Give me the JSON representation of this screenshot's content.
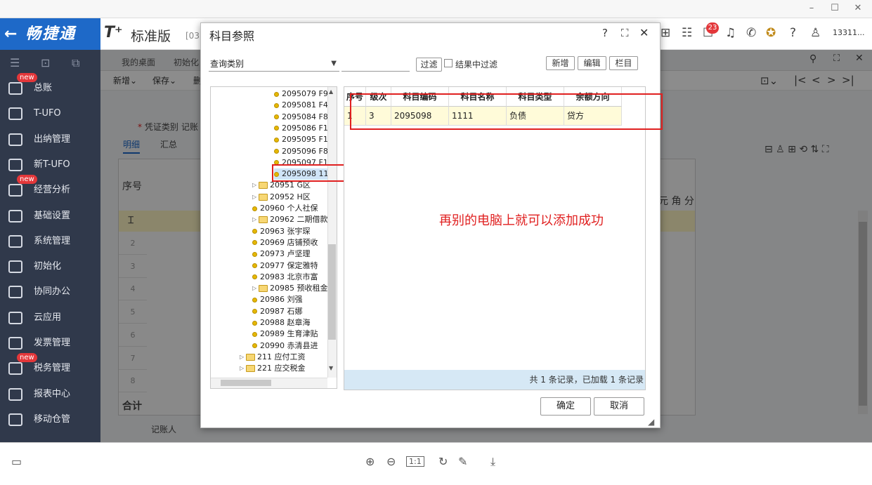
{
  "window": {
    "minimize": "–",
    "maximize": "☐",
    "close": "✕"
  },
  "brand": {
    "back_arrow": "←",
    "name": "畅捷通"
  },
  "header": {
    "logo_t": "T⁺",
    "edition": "标准版",
    "code": "[03",
    "notif_count": "23",
    "user": "13311..."
  },
  "sidebar": {
    "items": [
      {
        "label": "总账",
        "new": "new"
      },
      {
        "label": "T-UFO",
        "new": ""
      },
      {
        "label": "出纳管理",
        "new": ""
      },
      {
        "label": "新T-UFO",
        "new": ""
      },
      {
        "label": "经营分析",
        "new": "new"
      },
      {
        "label": "基础设置",
        "new": ""
      },
      {
        "label": "系统管理",
        "new": ""
      },
      {
        "label": "初始化",
        "new": ""
      },
      {
        "label": "协同办公",
        "new": ""
      },
      {
        "label": "云应用",
        "new": ""
      },
      {
        "label": "发票管理",
        "new": ""
      },
      {
        "label": "税务管理",
        "new": "new"
      },
      {
        "label": "报表中心",
        "new": ""
      },
      {
        "label": "移动仓管",
        "new": ""
      }
    ]
  },
  "tabs": {
    "desk": "我的桌面",
    "init": "初始化"
  },
  "toolbar": {
    "add": "新增",
    "save": "保存",
    "del": "删"
  },
  "form": {
    "voucher_type_label": "凭证类别",
    "voucher_type_value": "记账",
    "tab_detail": "明细",
    "tab_summary": "汇总",
    "col_seq": "序号",
    "col_units": "元 角 分",
    "total": "合计",
    "bookkeeper": "记账人",
    "rows": [
      "1",
      "2",
      "3",
      "4",
      "5",
      "6",
      "7",
      "8"
    ]
  },
  "dialog": {
    "title": "科目参照",
    "query_type": "查询类别",
    "filter_btn": "过滤",
    "filter_in_result": "结果中过滤",
    "new_btn": "新增",
    "edit_btn": "编辑",
    "column_btn": "栏目",
    "tree": [
      {
        "text": "2095079 F9",
        "kind": "leaf",
        "indent": 3
      },
      {
        "text": "2095081 F4",
        "kind": "leaf",
        "indent": 3
      },
      {
        "text": "2095084 F8",
        "kind": "leaf",
        "indent": 3
      },
      {
        "text": "2095086 F1",
        "kind": "leaf",
        "indent": 3
      },
      {
        "text": "2095095 F1",
        "kind": "leaf",
        "indent": 3
      },
      {
        "text": "2095096 F8",
        "kind": "leaf",
        "indent": 3
      },
      {
        "text": "2095097 F1",
        "kind": "leaf",
        "indent": 3
      },
      {
        "text": "2095098 11",
        "kind": "leaf",
        "indent": 3
      },
      {
        "text": "20951 G区",
        "kind": "folder",
        "indent": 2
      },
      {
        "text": "20952 H区",
        "kind": "folder",
        "indent": 2
      },
      {
        "text": "20960 个人社保",
        "kind": "leaf",
        "indent": 2
      },
      {
        "text": "20962 二期借款",
        "kind": "folder",
        "indent": 2
      },
      {
        "text": "20963 张宇琛",
        "kind": "leaf",
        "indent": 2
      },
      {
        "text": "20969 店铺预收",
        "kind": "leaf",
        "indent": 2
      },
      {
        "text": "20973 卢坚理",
        "kind": "leaf",
        "indent": 2
      },
      {
        "text": "20977 保定雅特",
        "kind": "leaf",
        "indent": 2
      },
      {
        "text": "20983 北京市富",
        "kind": "leaf",
        "indent": 2
      },
      {
        "text": "20985 预收租金",
        "kind": "folder",
        "indent": 2
      },
      {
        "text": "20986 刘强",
        "kind": "leaf",
        "indent": 2
      },
      {
        "text": "20987 石娜",
        "kind": "leaf",
        "indent": 2
      },
      {
        "text": "20988 赵章海",
        "kind": "leaf",
        "indent": 2
      },
      {
        "text": "20989 生育津贴",
        "kind": "leaf",
        "indent": 2
      },
      {
        "text": "20990 赤清县进",
        "kind": "leaf",
        "indent": 2
      },
      {
        "text": "211 应付工资",
        "kind": "folder",
        "indent": 1
      },
      {
        "text": "221 应交税金",
        "kind": "folder",
        "indent": 1
      }
    ],
    "grid_headers": [
      "序号",
      "级次",
      "科目编码",
      "科目名称",
      "科目类型",
      "余额方向"
    ],
    "grid_row": [
      "1",
      "3",
      "2095098",
      "1111",
      "负债",
      "贷方"
    ],
    "footer": "共 1 条记录，已加载 1 条记录",
    "ok": "确定",
    "cancel": "取消",
    "note": "再别的电脑上就可以添加成功"
  }
}
